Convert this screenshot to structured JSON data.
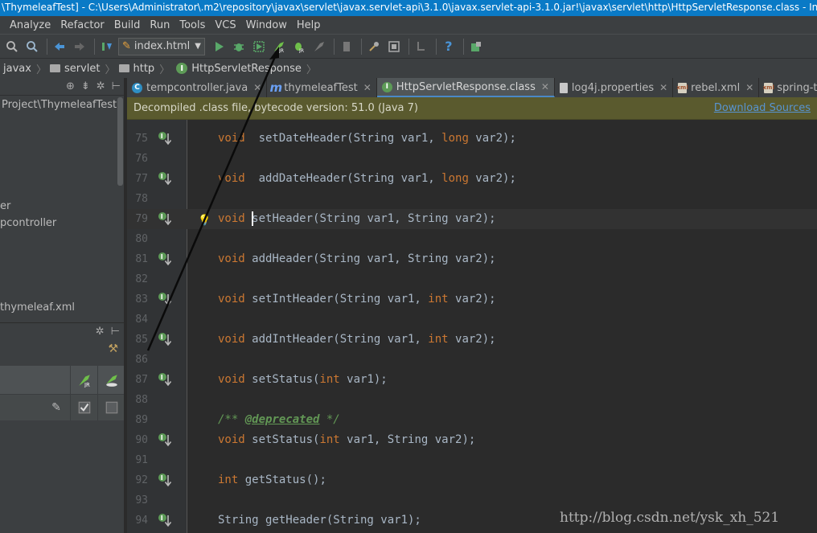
{
  "window": {
    "title": "\\ThymeleafTest] - C:\\Users\\Administrator\\.m2\\repository\\javax\\servlet\\javax.servlet-api\\3.1.0\\javax.servlet-api-3.1.0.jar!\\javax\\servlet\\http\\HttpServletResponse.class - IntelliJ ..."
  },
  "menu": [
    "Analyze",
    "Refactor",
    "Build",
    "Run",
    "Tools",
    "VCS",
    "Window",
    "Help"
  ],
  "toolbar": {
    "run_config": "index.html",
    "icons": [
      "find-icon",
      "replace-icon",
      "back-icon",
      "forward-icon",
      "make-icon",
      "run-config",
      "run-icon",
      "debug-icon",
      "coverage-icon",
      "jrebel-run-icon",
      "jrebel-debug-icon",
      "stop-icon",
      "structure-icon",
      "settings-icon",
      "project-structure-icon",
      "sdk-icon",
      "help-icon",
      "plugin-icon"
    ]
  },
  "breadcrumb": [
    "javax",
    "servlet",
    "http",
    "HttpServletResponse"
  ],
  "project": {
    "items": [
      "Project\\ThymeleafTest",
      "er",
      "pcontroller",
      "thymeleaf.xml"
    ]
  },
  "tabs": [
    {
      "label": "tempcontroller.java",
      "icon": "C"
    },
    {
      "label": "thymeleafTest",
      "icon": "m"
    },
    {
      "label": "HttpServletResponse.class",
      "icon": "I"
    },
    {
      "label": "log4j.properties",
      "icon": ""
    },
    {
      "label": "rebel.xml",
      "icon": "xml"
    },
    {
      "label": "spring-thymelea",
      "icon": "xml"
    }
  ],
  "notice": {
    "text": "Decompiled .class file, bytecode version: 51.0 (Java 7)",
    "link": "Download Sources"
  },
  "code": [
    {
      "n": "75",
      "icon": true,
      "parts": [
        [
          "kw",
          "void"
        ],
        [
          "",
          "  setDateHeader(String var1, "
        ],
        [
          "kw",
          "long"
        ],
        [
          "",
          " var2);"
        ]
      ]
    },
    {
      "n": "76",
      "icon": false,
      "parts": []
    },
    {
      "n": "77",
      "icon": true,
      "parts": [
        [
          "kw",
          "void"
        ],
        [
          "",
          "  addDateHeader(String var1, "
        ],
        [
          "kw",
          "long"
        ],
        [
          "",
          " var2);"
        ]
      ]
    },
    {
      "n": "78",
      "icon": false,
      "parts": []
    },
    {
      "n": "79",
      "icon": true,
      "parts": [
        [
          "kw",
          "void"
        ],
        [
          "",
          " "
        ],
        [
          "cur",
          ""
        ],
        [
          "",
          "setHeader(String var1, String var2);"
        ]
      ]
    },
    {
      "n": "80",
      "icon": false,
      "parts": []
    },
    {
      "n": "81",
      "icon": true,
      "parts": [
        [
          "kw",
          "void"
        ],
        [
          "",
          " addHeader(String var1, String var2);"
        ]
      ]
    },
    {
      "n": "82",
      "icon": false,
      "parts": []
    },
    {
      "n": "83",
      "icon": true,
      "parts": [
        [
          "kw",
          "void"
        ],
        [
          "",
          " setIntHeader(String var1, "
        ],
        [
          "kw",
          "int"
        ],
        [
          "",
          " var2);"
        ]
      ]
    },
    {
      "n": "84",
      "icon": false,
      "parts": []
    },
    {
      "n": "85",
      "icon": true,
      "parts": [
        [
          "kw",
          "void"
        ],
        [
          "",
          " addIntHeader(String var1, "
        ],
        [
          "kw",
          "int"
        ],
        [
          "",
          " var2);"
        ]
      ]
    },
    {
      "n": "86",
      "icon": false,
      "parts": []
    },
    {
      "n": "87",
      "icon": true,
      "parts": [
        [
          "kw",
          "void"
        ],
        [
          "",
          " setStatus("
        ],
        [
          "kw",
          "int"
        ],
        [
          "",
          " var1);"
        ]
      ]
    },
    {
      "n": "88",
      "icon": false,
      "parts": []
    },
    {
      "n": "89",
      "icon": false,
      "parts": [
        [
          "cmt",
          "/** "
        ],
        [
          "tag",
          "@deprecated"
        ],
        [
          "cmt",
          " */"
        ]
      ]
    },
    {
      "n": "90",
      "icon": true,
      "parts": [
        [
          "kw",
          "void"
        ],
        [
          "",
          " setStatus("
        ],
        [
          "kw",
          "int"
        ],
        [
          "",
          " var1, String var2);"
        ]
      ]
    },
    {
      "n": "91",
      "icon": false,
      "parts": []
    },
    {
      "n": "92",
      "icon": true,
      "parts": [
        [
          "kw",
          "int"
        ],
        [
          "",
          " getStatus();"
        ]
      ]
    },
    {
      "n": "93",
      "icon": false,
      "parts": []
    },
    {
      "n": "94",
      "icon": true,
      "parts": [
        [
          "",
          "String getHeader(String var1);"
        ]
      ]
    }
  ],
  "watermark": "http://blog.csdn.net/ysk_xh_521",
  "colors": {
    "accent": "#4a88c7",
    "keyword": "#cc7832",
    "title_bar": "#0a7ac6"
  }
}
